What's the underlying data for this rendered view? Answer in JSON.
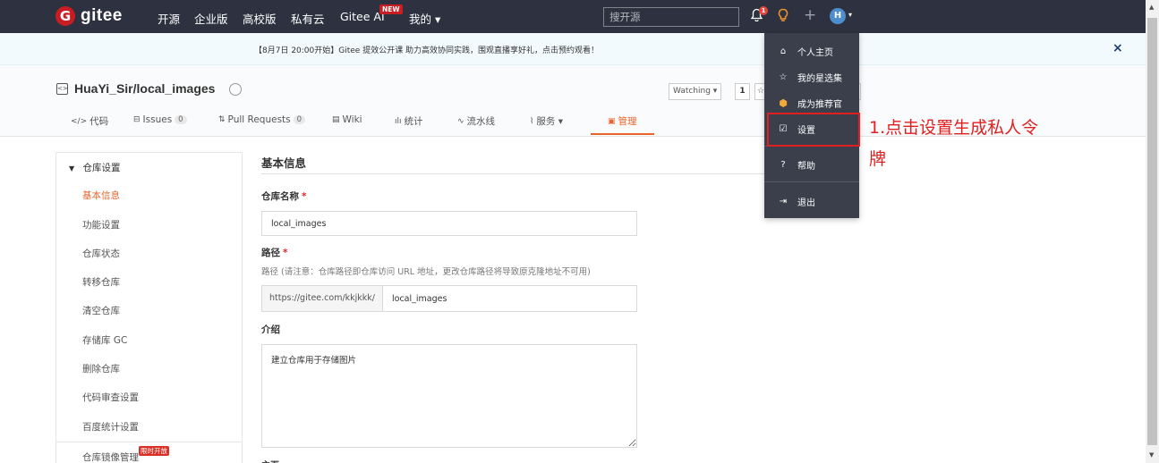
{
  "nav": {
    "logo_letter": "G",
    "logo_text": "gitee",
    "links": [
      "开源",
      "企业版",
      "高校版",
      "私有云",
      "Gitee AI",
      "我的 ▾"
    ],
    "new_badge": "NEW",
    "search_placeholder": "搜开源",
    "bell_count": "1",
    "avatar_letter": "H"
  },
  "banner": {
    "text": "【8月7日 20:00开始】Gitee 提效公开课 助力高效协同实践，围观直播享好礼，点击预约观看！",
    "close": "×"
  },
  "repo": {
    "title": "HuaYi_Sir/local_images",
    "watch_label": "Watching ▾",
    "watch_count": "1",
    "tabs": [
      {
        "label": "代码",
        "count": ""
      },
      {
        "label": "Issues",
        "count": "0"
      },
      {
        "label": "Pull Requests",
        "count": "0"
      },
      {
        "label": "Wiki",
        "count": ""
      },
      {
        "label": "统计",
        "count": ""
      },
      {
        "label": "流水线",
        "count": ""
      },
      {
        "label": "服务 ▾",
        "count": ""
      },
      {
        "label": "管理",
        "count": ""
      }
    ]
  },
  "sidebar": {
    "header": "仓库设置",
    "items": [
      "基本信息",
      "功能设置",
      "仓库状态",
      "转移仓库",
      "清空仓库",
      "存储库 GC",
      "删除仓库",
      "代码审查设置",
      "百度统计设置",
      "仓库镜像管理"
    ],
    "limited_badge": "限时开放"
  },
  "form": {
    "section_title": "基本信息",
    "name_label": "仓库名称",
    "name_value": "local_images",
    "path_label": "路径",
    "path_hint": "路径 (请注意：仓库路径即仓库访问 URL 地址，更改仓库路径将导致原克隆地址不可用)",
    "path_prefix": "https://gitee.com/kkjkkk/",
    "path_value": "local_images",
    "intro_label": "介绍",
    "intro_value": "建立仓库用于存储图片",
    "required_mark": "*",
    "next_label": "主页"
  },
  "dropdown": {
    "items": [
      {
        "label": "个人主页",
        "icon": "home-icon"
      },
      {
        "label": "我的星选集",
        "icon": "star-icon"
      },
      {
        "label": "成为推荐官",
        "icon": "shield-icon"
      },
      {
        "label": "设置",
        "icon": "settings-icon"
      },
      {
        "label": "帮助",
        "icon": "help-icon"
      },
      {
        "label": "退出",
        "icon": "logout-icon"
      }
    ]
  },
  "annotation": "1.点击设置生成私人令牌",
  "colors": {
    "nav_bg": "#2e3240",
    "accent": "#e9642b",
    "brand_red": "#c71d23",
    "annotation_red": "#e02020",
    "dropdown_bg": "#3b3f4c"
  }
}
